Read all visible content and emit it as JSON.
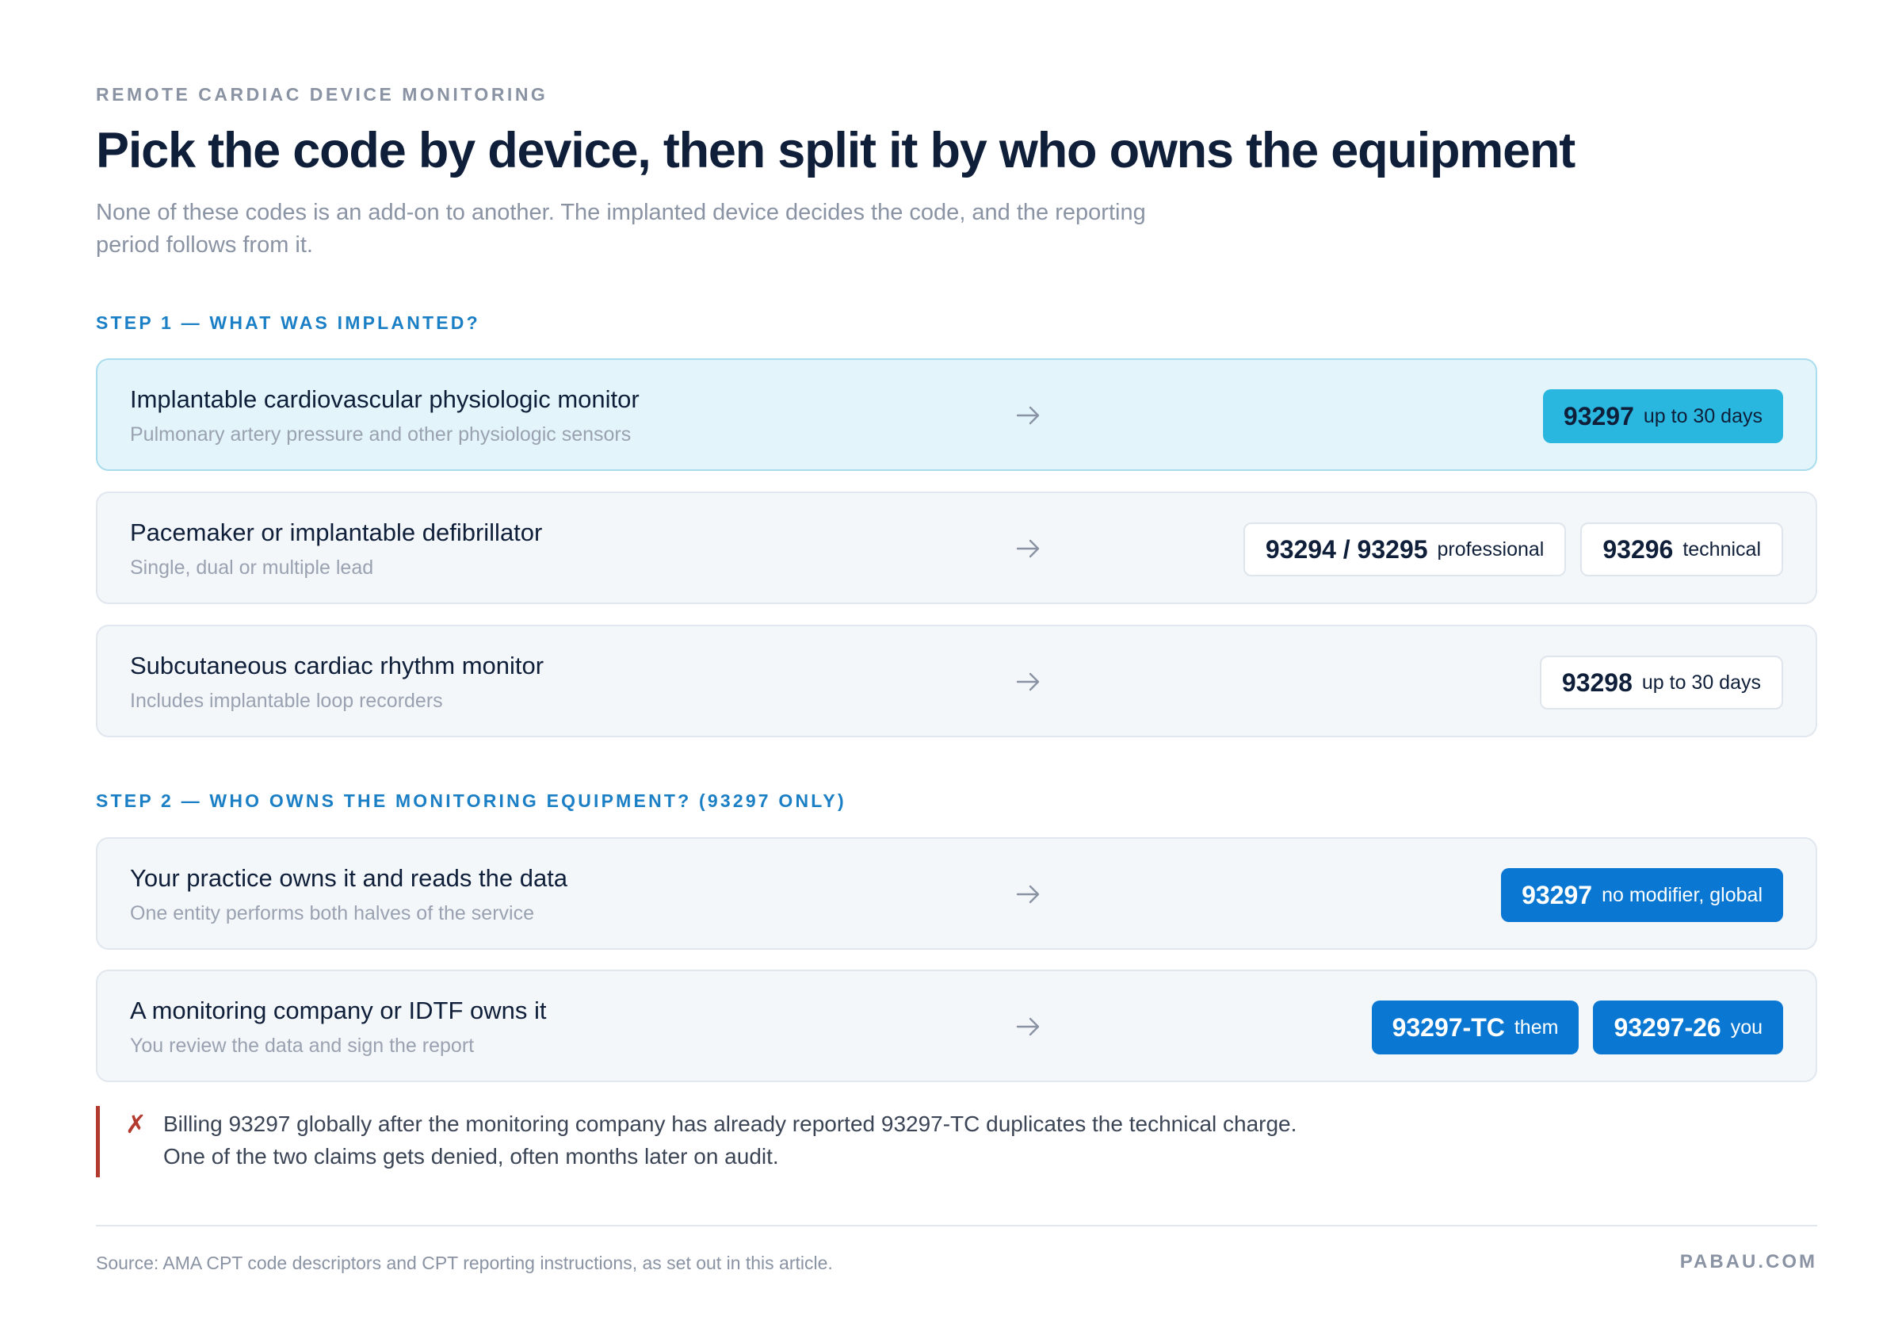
{
  "header": {
    "eyebrow": "REMOTE CARDIAC DEVICE MONITORING",
    "title": "Pick the code by device, then split it by who owns the equipment",
    "subtitle_line1": "None of these codes is an add-on to another. The implanted device decides the code, and the reporting",
    "subtitle_line2": "period follows from it."
  },
  "step1": {
    "label": "STEP 1 — WHAT WAS IMPLANTED?",
    "rows": [
      {
        "title": "Implantable cardiovascular physiologic monitor",
        "subtitle": "Pulmonary artery pressure and other physiologic sensors",
        "pills": [
          {
            "code": "93297",
            "note": "up to 30 days"
          }
        ]
      },
      {
        "title": "Pacemaker or implantable defibrillator",
        "subtitle": "Single, dual or multiple lead",
        "pills": [
          {
            "code": "93294 / 93295",
            "note": "professional"
          },
          {
            "code": "93296",
            "note": "technical"
          }
        ]
      },
      {
        "title": "Subcutaneous cardiac rhythm monitor",
        "subtitle": "Includes implantable loop recorders",
        "pills": [
          {
            "code": "93298",
            "note": "up to 30 days"
          }
        ]
      }
    ]
  },
  "step2": {
    "label": "STEP 2 — WHO OWNS THE MONITORING EQUIPMENT? (93297 ONLY)",
    "rows": [
      {
        "title": "Your practice owns it and reads the data",
        "subtitle": "One entity performs both halves of the service",
        "pills": [
          {
            "code": "93297",
            "note": "no modifier, global"
          }
        ]
      },
      {
        "title": "A monitoring company or IDTF owns it",
        "subtitle": "You review the data and sign the report",
        "pills": [
          {
            "code": "93297-TC",
            "note": "them"
          },
          {
            "code": "93297-26",
            "note": "you"
          }
        ]
      }
    ]
  },
  "warning": {
    "icon": "cross-icon",
    "line1": "Billing 93297 globally after the monitoring company has already reported 93297-TC duplicates the technical charge.",
    "line2": "One of the two claims gets denied, often months later on audit."
  },
  "footer": {
    "source": "Source: AMA CPT code descriptors and CPT reporting instructions, as set out in this article.",
    "brand": "PABAU.COM"
  },
  "colors": {
    "navy": "#0f1f3a",
    "accent_blue": "#0a78d2",
    "teal": "#29b7df",
    "step_label": "#1b7fc6",
    "warning_red": "#b23a2e"
  }
}
